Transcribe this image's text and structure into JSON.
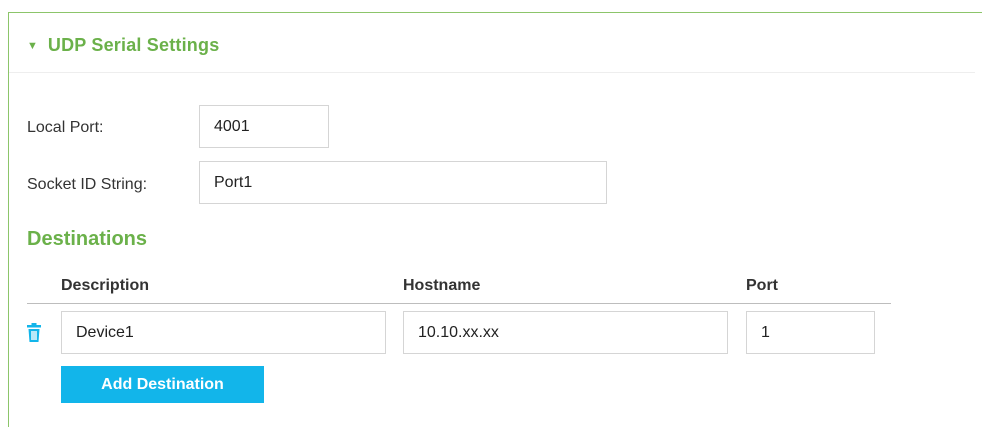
{
  "panel": {
    "title": "UDP Serial Settings",
    "caret_icon": "caret-down-icon",
    "accent_color": "#6bb14a"
  },
  "form": {
    "local_port_label": "Local Port:",
    "local_port_value": "4001",
    "socket_id_label": "Socket ID String:",
    "socket_id_value": "Port1"
  },
  "destinations": {
    "title": "Destinations",
    "columns": [
      "Description",
      "Hostname",
      "Port"
    ],
    "rows": [
      {
        "description": "Device1",
        "hostname": "10.10.xx.xx",
        "port": "1",
        "delete_icon": "trash-icon"
      }
    ],
    "add_button_label": "Add Destination",
    "button_color": "#12b5ea"
  }
}
